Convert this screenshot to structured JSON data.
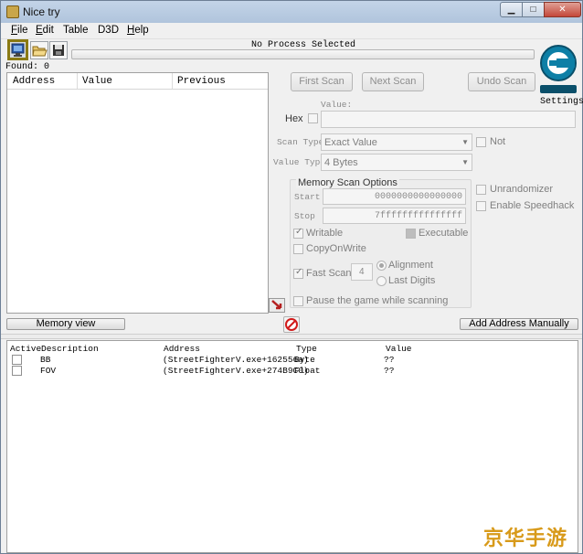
{
  "window": {
    "title": "Nice try"
  },
  "menu": [
    {
      "label": "File",
      "underline": "F",
      "rest": "ile"
    },
    {
      "label": "Edit",
      "underline": "E",
      "rest": "dit"
    },
    {
      "label": "Table"
    },
    {
      "label": "D3D"
    },
    {
      "label": "Help",
      "underline": "H",
      "rest": "elp"
    }
  ],
  "toolbar": {
    "process_label": "No Process Selected",
    "found_label": "Found: 0"
  },
  "logo": {
    "settings_label": "Settings",
    "icon": "cheat-engine-logo"
  },
  "results": {
    "columns": [
      "Address",
      "Value",
      "Previous"
    ]
  },
  "scan": {
    "first_scan": "First Scan",
    "next_scan": "Next Scan",
    "undo_scan": "Undo Scan",
    "value_label": "Value:",
    "hex_label": "Hex",
    "scan_type_label": "Scan Type",
    "scan_type_value": "Exact Value",
    "value_type_label": "Value Type",
    "value_type_value": "4 Bytes",
    "not_label": "Not"
  },
  "memory_scan": {
    "title": "Memory Scan Options",
    "start_label": "Start",
    "start_value": "0000000000000000",
    "stop_label": "Stop",
    "stop_value": "7fffffffffffffff",
    "writable": "Writable",
    "executable": "Executable",
    "copy_on_write": "CopyOnWrite",
    "fast_scan": "Fast Scan",
    "fast_scan_value": "4",
    "alignment": "Alignment",
    "last_digits": "Last Digits",
    "pause_game": "Pause the game while scanning"
  },
  "options": {
    "unrandomizer": "Unrandomizer",
    "speedhack": "Enable Speedhack"
  },
  "bottom_buttons": {
    "memory_view": "Memory view",
    "add_address": "Add Address Manually"
  },
  "address_table": {
    "columns": [
      "Active",
      "Description",
      "Address",
      "Type",
      "Value"
    ],
    "rows": [
      {
        "description": "BB",
        "address": "(StreetFighterV.exe+162556a)",
        "type": "Byte",
        "value": "??"
      },
      {
        "description": "FOV",
        "address": "(StreetFighterV.exe+274B9C0)",
        "type": "Float",
        "value": "??"
      }
    ]
  },
  "watermark": "京华手游网",
  "colors": {
    "titlebar": "#b9cbe1",
    "close_button": "#c4473a",
    "logo": "#0d7fa6",
    "watermark": "#d89a1a"
  }
}
